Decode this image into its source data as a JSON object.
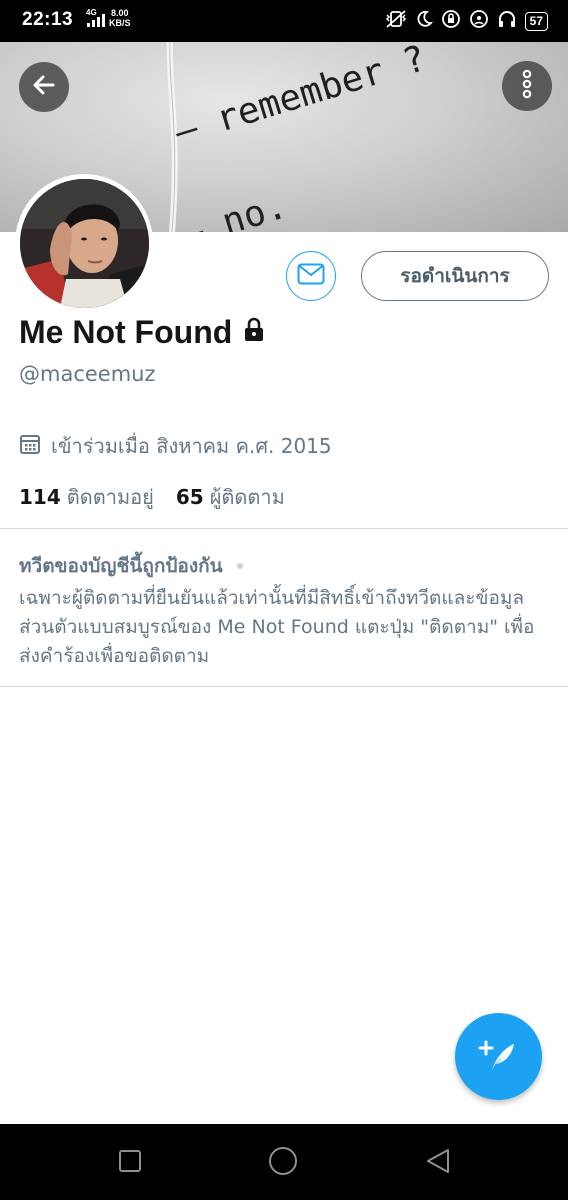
{
  "status_bar": {
    "time": "22:13",
    "network": "4G",
    "speed_value": "8.00",
    "speed_unit": "KB/S",
    "battery": "57"
  },
  "banner": {
    "line1": "– remember ?",
    "line2": "– no."
  },
  "profile": {
    "display_name": "Me Not Found",
    "handle": "@maceemuz",
    "joined": "เข้าร่วมเมื่อ สิงหาคม ค.ศ. 2015",
    "following_count": "114",
    "following_label": "ติดตามอยู่",
    "followers_count": "65",
    "followers_label": "ผู้ติดตาม"
  },
  "actions": {
    "pending_label": "รอดำเนินการ"
  },
  "protected_notice": {
    "title": "ทวีตของบัญชีนี้ถูกป้องกัน",
    "body": "เฉพาะผู้ติดตามที่ยืนยันแล้วเท่านั้นที่มีสิทธิ์เข้าถึงทวีตและข้อมูลส่วนตัวแบบสมบูรณ์ของ Me Not Found แตะปุ่ม \"ติดตาม\" เพื่อส่งคำร้องเพื่อขอติดตาม"
  },
  "colors": {
    "accent": "#1da1f2",
    "secondary_text": "#657786",
    "primary_text": "#14171a",
    "divider": "#d6dde2"
  },
  "icons": [
    "back-arrow-icon",
    "more-vertical-icon",
    "envelope-icon",
    "lock-icon",
    "calendar-icon",
    "compose-feather-icon"
  ]
}
